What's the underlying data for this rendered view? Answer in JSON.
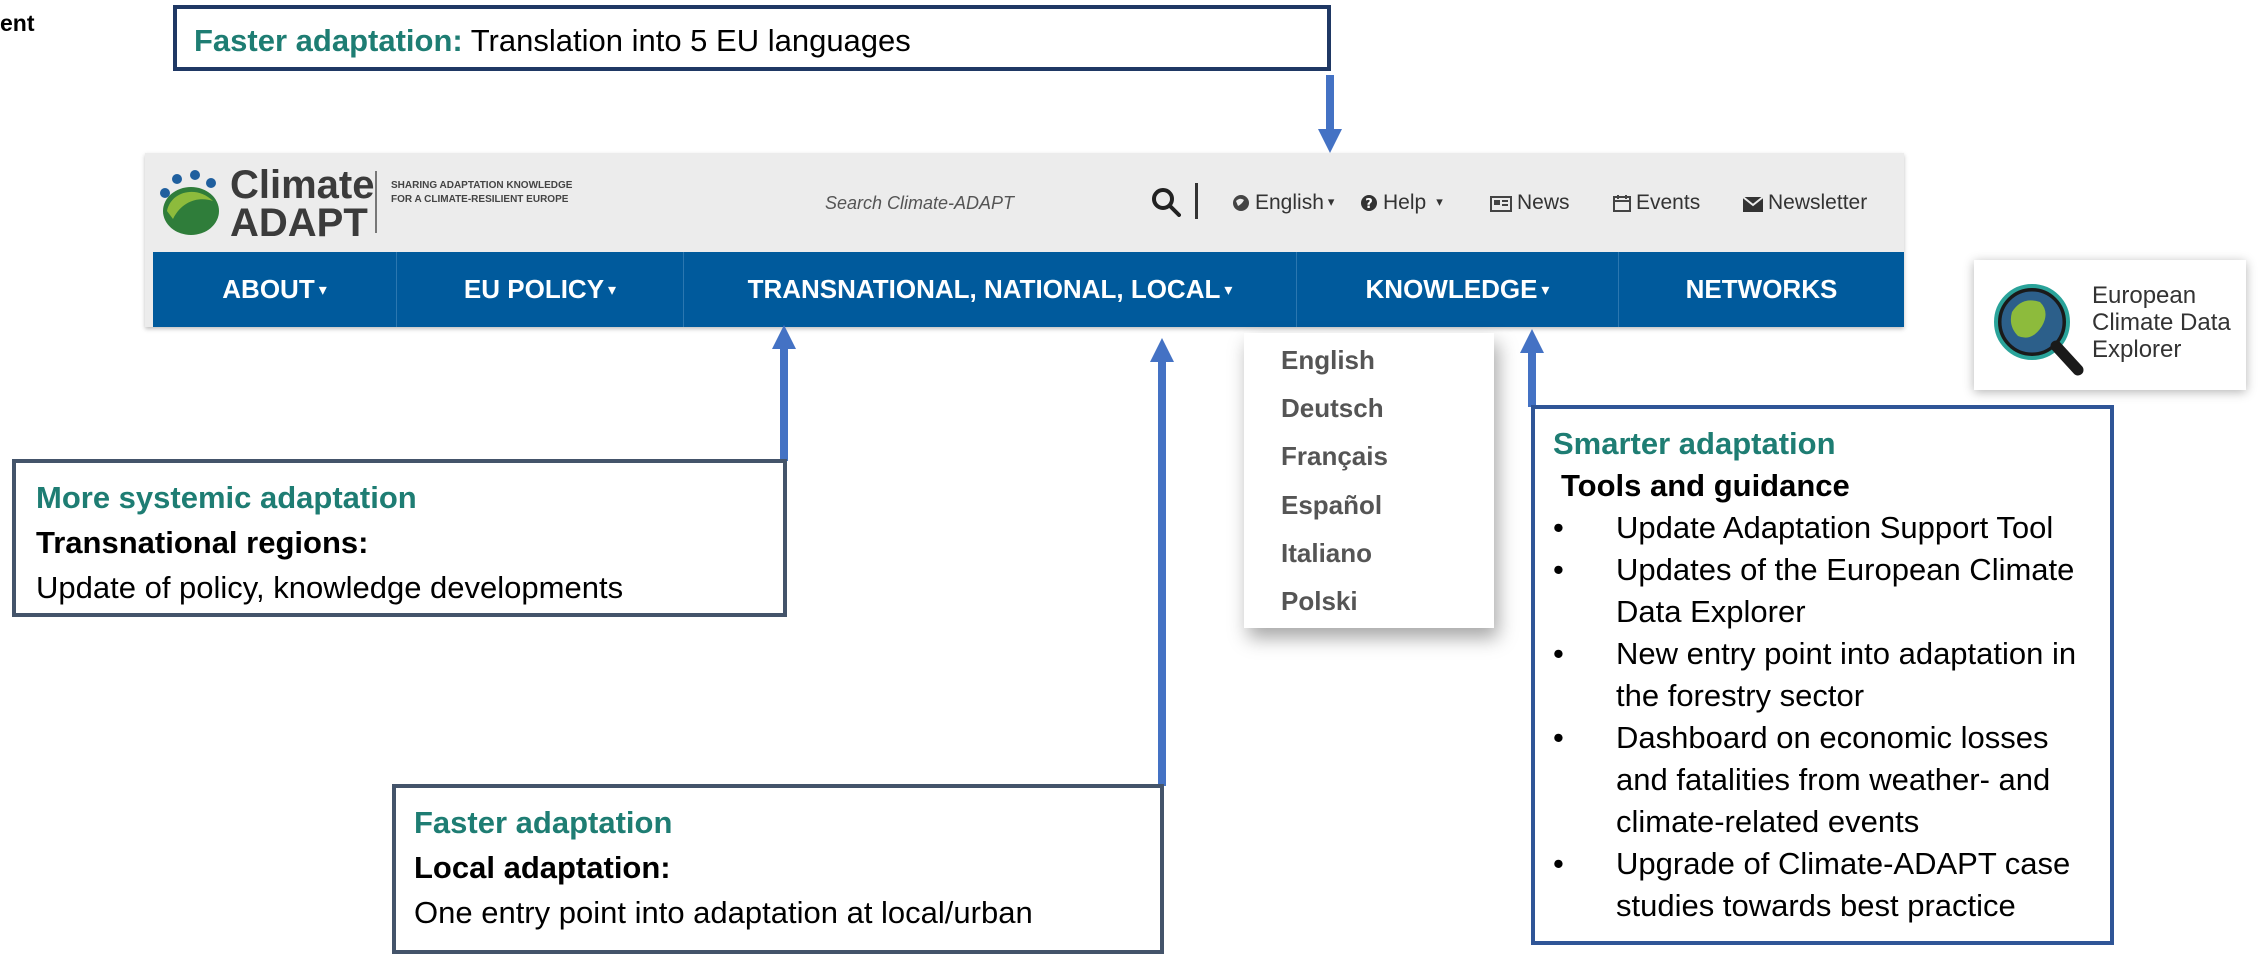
{
  "corner_text": "ent",
  "top_callout": {
    "lead": "Faster adaptation:",
    "text": " Translation into 5 EU languages"
  },
  "header": {
    "logo_word1": "Climate",
    "logo_word2": "ADAPT",
    "tagline": "SHARING ADAPTATION KNOWLEDGE FOR A CLIMATE-RESILIENT EUROPE",
    "search_placeholder": "Search Climate-ADAPT",
    "language": "English",
    "help": "Help",
    "news": "News",
    "events": "Events",
    "newsletter": "Newsletter"
  },
  "nav": {
    "about": "ABOUT",
    "eu_policy": "EU POLICY",
    "transnational": "TRANSNATIONAL, NATIONAL, LOCAL",
    "knowledge": "KNOWLEDGE",
    "networks": "NETWORKS"
  },
  "languages": [
    "English",
    "Deutsch",
    "Français",
    "Español",
    "Italiano",
    "Polski"
  ],
  "ecde": {
    "line1": "European",
    "line2": "Climate Data",
    "line3": "Explorer"
  },
  "systemic_callout": {
    "lead": "More systemic adaptation",
    "heading": "Transnational regions:",
    "text": "Update of policy, knowledge developments"
  },
  "local_callout": {
    "lead": "Faster adaptation",
    "heading": "Local adaptation:",
    "text": "One entry point into adaptation at local/urban"
  },
  "smarter_callout": {
    "lead": "Smarter adaptation",
    "heading": "Tools and guidance",
    "items": [
      "Update Adaptation  Support Tool",
      "Updates of the European Climate Data Explorer",
      "New entry point into adaptation in the forestry sector",
      "Dashboard on economic losses and fatalities from weather- and climate-related events",
      "Upgrade of Climate-ADAPT case studies towards best practice"
    ]
  },
  "colors": {
    "teal": "#1e7d73",
    "nav_blue": "#005a9c",
    "arrow_blue": "#4472c4",
    "box_navy": "#1f3864"
  }
}
